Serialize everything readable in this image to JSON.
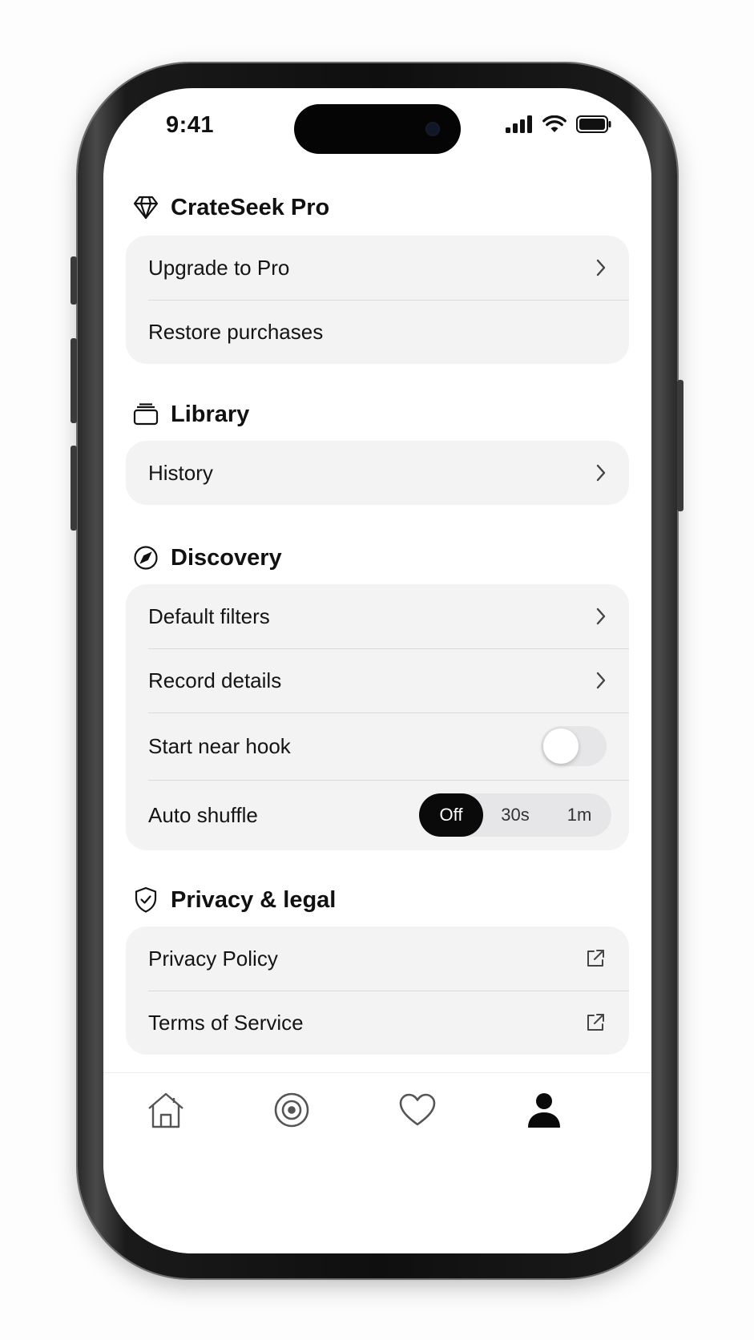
{
  "status_bar": {
    "time": "9:41"
  },
  "sections": {
    "pro": {
      "title": "CrateSeek Pro",
      "icon": "diamond-icon",
      "rows": [
        "Upgrade to Pro",
        "Restore purchases"
      ]
    },
    "library": {
      "title": "Library",
      "icon": "stack-icon",
      "rows": [
        "History"
      ]
    },
    "discovery": {
      "title": "Discovery",
      "icon": "compass-icon",
      "rows": [
        "Default filters",
        "Record details",
        "Start near hook",
        "Auto shuffle"
      ],
      "start_near_hook_on": false,
      "auto_shuffle": {
        "options": [
          "Off",
          "30s",
          "1m"
        ],
        "selected": "Off"
      }
    },
    "privacy": {
      "title": "Privacy & legal",
      "icon": "shield-check-icon",
      "rows": [
        "Privacy Policy",
        "Terms of Service"
      ]
    }
  },
  "tabbar": {
    "items": [
      "home-icon",
      "target-icon",
      "heart-icon",
      "person-icon"
    ],
    "active": "person-icon"
  },
  "colors": {
    "card_bg": "#f3f3f4",
    "accent": "#0a0a0a",
    "toggle_off": "#e6e6e8"
  }
}
